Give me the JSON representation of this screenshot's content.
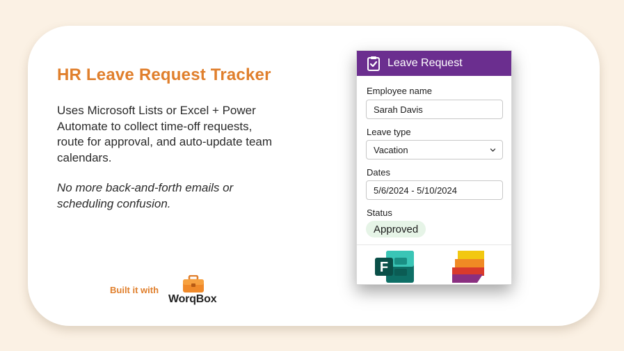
{
  "slide": {
    "title": "HR Leave Request Tracker",
    "description": "Uses Microsoft Lists or Excel + Power Automate to collect time-off requests, route for approval, and auto-update team calendars.",
    "tagline": "No more back-and-forth emails or scheduling confusion.",
    "built_with": "Built it with",
    "brand": "WorqBox"
  },
  "form": {
    "header_title": "Leave Request",
    "employee_name_label": "Employee name",
    "employee_name_value": "Sarah Davis",
    "leave_type_label": "Leave type",
    "leave_type_value": "Vacation",
    "dates_label": "Dates",
    "dates_value": "5/6/2024 - 5/10/2024",
    "status_label": "Status",
    "status_value": "Approved"
  },
  "icons": {
    "header": "clipboard-check-icon",
    "dropdown": "chevron-down-icon",
    "brand": "briefcase-icon",
    "app_1": "microsoft-forms-logo",
    "app_2": "microsoft-lists-logo"
  },
  "colors": {
    "accent_orange": "#e07f2c",
    "header_purple": "#6b2e8f",
    "status_green_bg": "#e6f4e7",
    "background": "#fbf1e4"
  }
}
